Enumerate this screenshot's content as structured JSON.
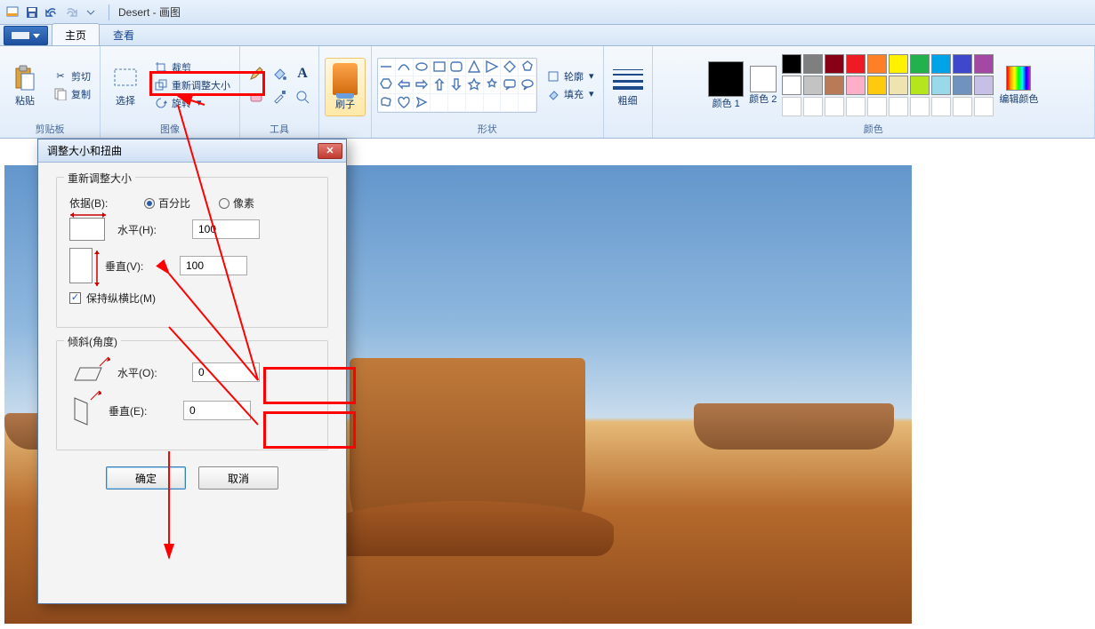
{
  "title": "Desert - 画图",
  "tabs": {
    "file": "",
    "home": "主页",
    "view": "查看"
  },
  "ribbon": {
    "clipboard": {
      "paste": "粘贴",
      "cut": "剪切",
      "copy": "复制",
      "label": "剪贴板"
    },
    "image": {
      "select": "选择",
      "crop": "裁剪",
      "resize": "重新调整大小",
      "rotate": "旋转",
      "label": "图像"
    },
    "tools": {
      "label": "工具"
    },
    "brush": {
      "label": "刷子"
    },
    "shapes": {
      "outline": "轮廓",
      "fill": "填充",
      "label": "形状"
    },
    "thickness": {
      "label": "粗细"
    },
    "colors": {
      "c1": "颜色 1",
      "c2": "颜色 2",
      "edit": "编辑颜色",
      "label": "颜色"
    }
  },
  "palette_row1": [
    "#000000",
    "#7f7f7f",
    "#880015",
    "#ed1c24",
    "#ff7f27",
    "#fff200",
    "#22b14c",
    "#00a2e8",
    "#3f48cc",
    "#a349a4"
  ],
  "palette_row2": [
    "#ffffff",
    "#c3c3c3",
    "#b97a57",
    "#ffaec9",
    "#ffc90e",
    "#efe4b0",
    "#b5e61d",
    "#99d9ea",
    "#7092be",
    "#c8bfe7"
  ],
  "dialog": {
    "title": "调整大小和扭曲",
    "resize": {
      "legend": "重新调整大小",
      "by": "依据(B):",
      "percent": "百分比",
      "pixels": "像素",
      "horizontal": "水平(H):",
      "vertical": "垂直(V):",
      "h_value": "100",
      "v_value": "100",
      "keep_ratio": "保持纵横比(M)"
    },
    "skew": {
      "legend": "倾斜(角度)",
      "horizontal": "水平(O):",
      "vertical": "垂直(E):",
      "h_value": "0",
      "v_value": "0"
    },
    "ok": "确定",
    "cancel": "取消"
  }
}
